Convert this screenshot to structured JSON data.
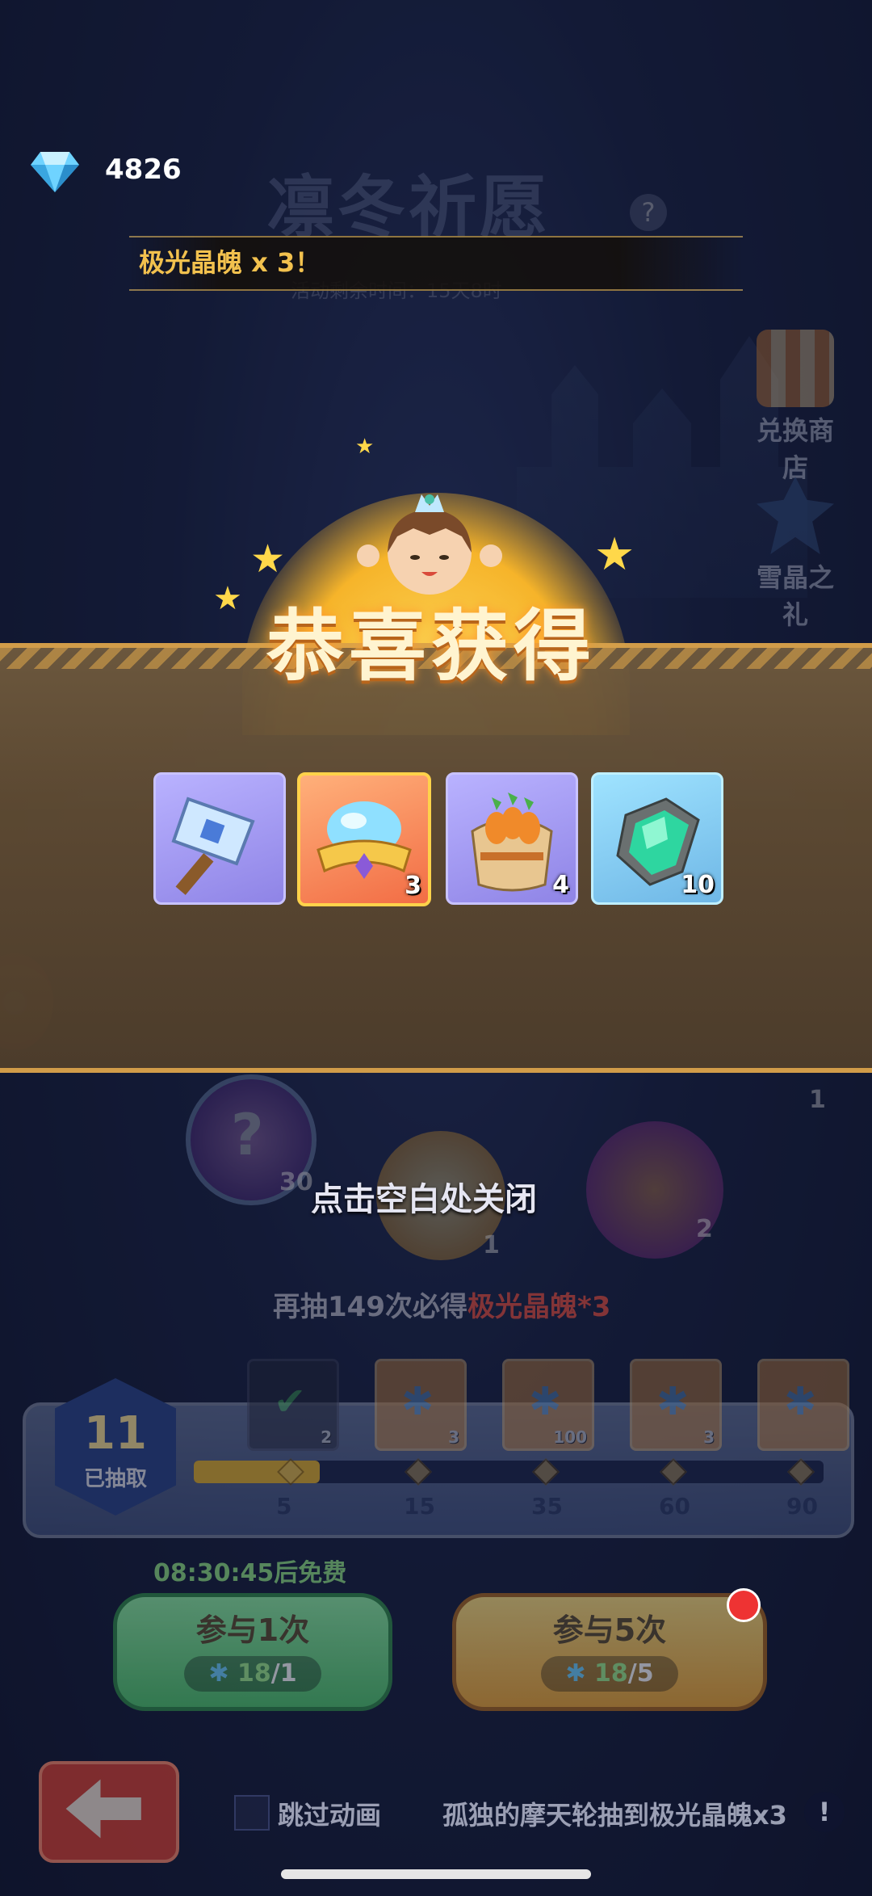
{
  "currency": {
    "gems": "4826"
  },
  "header": {
    "title": "凛冬祈愿",
    "help": "?",
    "timer_label": "活动剩余时间：15天8时"
  },
  "announcement": {
    "prefix": "极光晶魄",
    "suffix": "x 3！"
  },
  "side_buttons": [
    {
      "label": "兑换商店"
    },
    {
      "label": "雪晶之礼"
    }
  ],
  "reward_popup": {
    "title": "恭喜获得",
    "items": [
      {
        "name": "hammer",
        "rarity": "purple",
        "quantity": ""
      },
      {
        "name": "aurora-crystal-crown",
        "rarity": "orange",
        "quantity": "3"
      },
      {
        "name": "carrot-sack",
        "rarity": "purple",
        "quantity": "4"
      },
      {
        "name": "emerald-ore",
        "rarity": "blue",
        "quantity": "10"
      }
    ],
    "close_hint": "点击空白处关闭"
  },
  "background_orbs": [
    {
      "qty": "30"
    },
    {
      "qty": "1"
    },
    {
      "qty": "2"
    },
    {
      "qty": "1"
    }
  ],
  "pity": {
    "text_a": "再抽",
    "count": "149",
    "text_b": "次必得",
    "item": "极光晶魄",
    "mult": "*3"
  },
  "progress": {
    "draws_count": "11",
    "draws_label": "已抽取",
    "fraction_filled": 0.2,
    "milestones": [
      {
        "label": "5",
        "qty": "2",
        "claimed": true
      },
      {
        "label": "15",
        "qty": "3",
        "claimed": false
      },
      {
        "label": "35",
        "qty": "100",
        "claimed": false
      },
      {
        "label": "60",
        "qty": "3",
        "claimed": false
      },
      {
        "label": "90",
        "qty": "",
        "claimed": false
      }
    ]
  },
  "free_timer": "08:30:45后免费",
  "buttons": {
    "draw1": {
      "label": "参与1次",
      "have": "18",
      "need": "/1"
    },
    "draw5": {
      "label": "参与5次",
      "have": "18",
      "need": "/5"
    }
  },
  "footer": {
    "skip_label": "跳过动画",
    "marquee": "孤独的摩天轮抽到极光晶魄x3",
    "info": "!"
  },
  "colors": {
    "accent_gold": "#d9a24a",
    "pity_red": "#e5554b",
    "green": "#4fc86a",
    "yellow": "#f1a832"
  }
}
